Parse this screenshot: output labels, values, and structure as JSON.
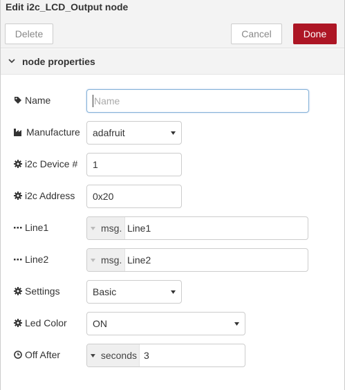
{
  "tray": {
    "title": "Edit i2c_LCD_Output node",
    "delete_label": "Delete",
    "cancel_label": "Cancel",
    "done_label": "Done"
  },
  "section": {
    "title": "node properties"
  },
  "fields": {
    "name": {
      "label": "Name",
      "placeholder": "Name",
      "value": "",
      "icon": "tag-icon"
    },
    "manufacture": {
      "label": "Manufacture",
      "value": "adafruit",
      "icon": "industry-icon"
    },
    "device": {
      "label": "i2c Device #",
      "value": "1",
      "icon": "gear-icon"
    },
    "address": {
      "label": "i2c Address",
      "value": "0x20",
      "icon": "gear-icon"
    },
    "line1": {
      "label": "Line1",
      "type": "msg.",
      "value": "Line1",
      "icon": "ellipsis-icon"
    },
    "line2": {
      "label": "Line2",
      "type": "msg.",
      "value": "Line2",
      "icon": "ellipsis-icon"
    },
    "settings": {
      "label": "Settings",
      "value": "Basic",
      "icon": "gear-icon"
    },
    "led_color": {
      "label": "Led Color",
      "value": "ON",
      "icon": "gear-icon"
    },
    "off_after": {
      "label": "Off After",
      "type": "seconds",
      "value": "3",
      "icon": "clock-icon"
    }
  },
  "colors": {
    "done_bg": "#ad1625",
    "header_bg": "#f3f3f3",
    "focus_border": "#85b2d8"
  }
}
